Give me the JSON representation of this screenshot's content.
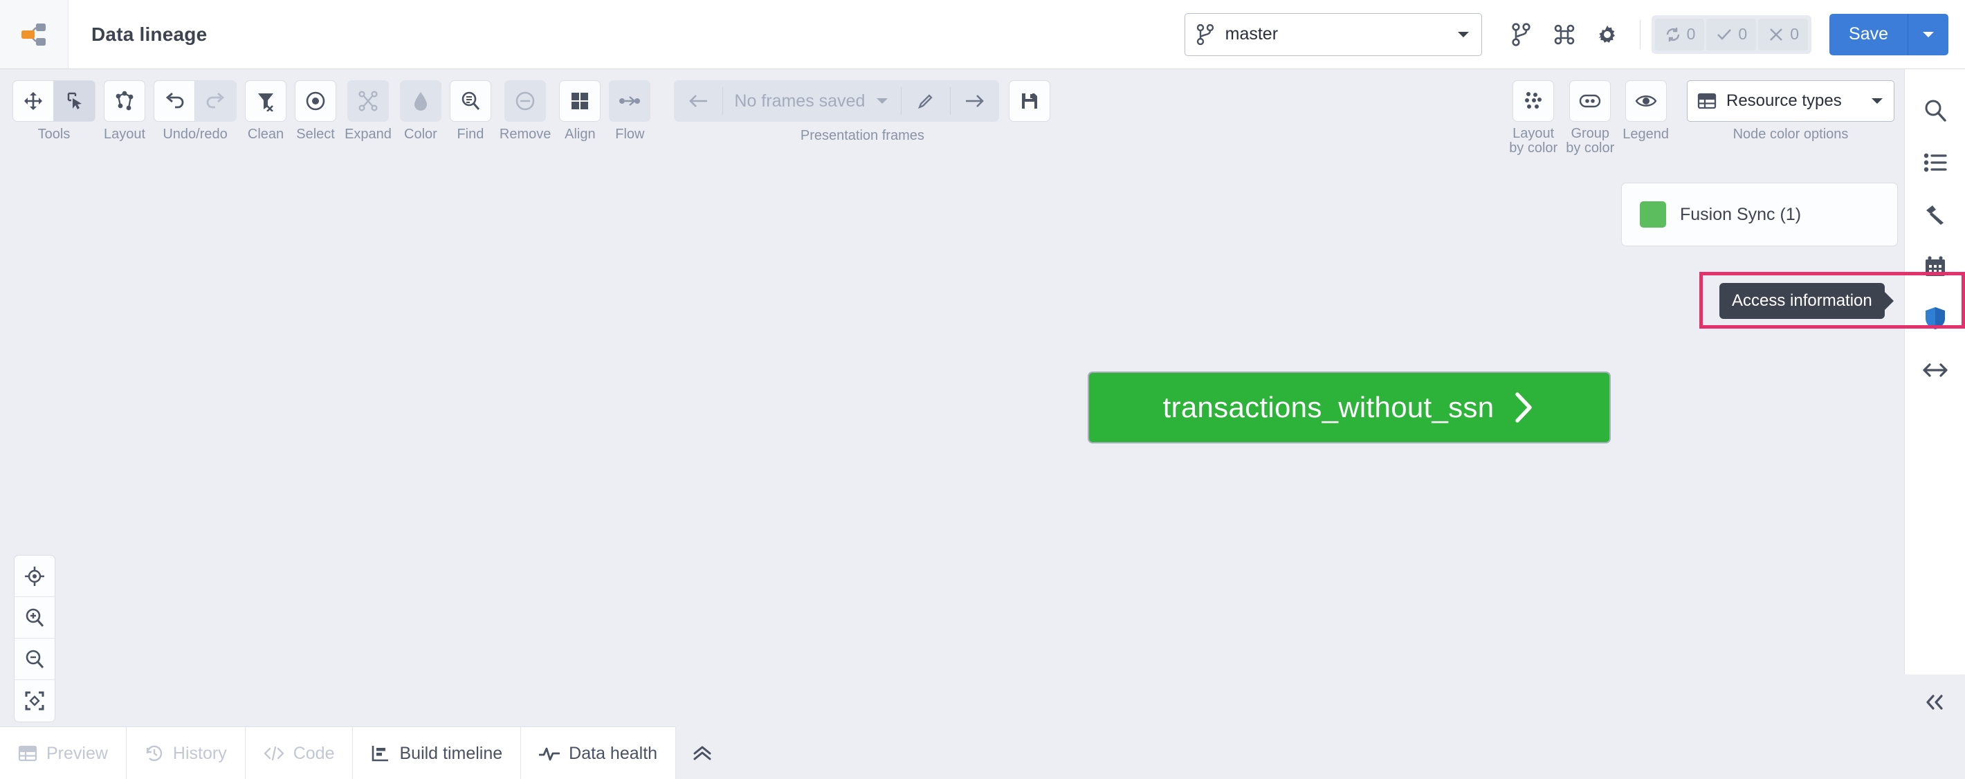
{
  "header": {
    "logo_icon": "lineage-graph-logo",
    "title": "Data lineage",
    "branch": {
      "icon": "branch-icon",
      "value": "master",
      "caret_icon": "chevron-down-icon"
    },
    "actions": [
      {
        "name": "branch-merge-button",
        "icon": "branch-merge-icon"
      },
      {
        "name": "command-button",
        "icon": "command-icon"
      },
      {
        "name": "settings-button",
        "icon": "gear-icon"
      }
    ],
    "status": [
      {
        "name": "status-pending",
        "icon": "sync-icon",
        "count": "0"
      },
      {
        "name": "status-success",
        "icon": "check-icon",
        "count": "0"
      },
      {
        "name": "status-failed",
        "icon": "close-icon",
        "count": "0"
      }
    ],
    "save_label": "Save",
    "save_caret_icon": "chevron-down-icon"
  },
  "toolbar": {
    "groups": [
      {
        "label": "Tools",
        "buttons": [
          "move-icon",
          "select-pointer-icon"
        ],
        "active_index": 1
      },
      {
        "label": "Layout",
        "buttons": [
          "layout-graph-icon"
        ]
      },
      {
        "label": "Undo/redo",
        "buttons": [
          "undo-icon",
          "redo-icon"
        ],
        "disabled_index": 1
      },
      {
        "label": "Clean",
        "buttons": [
          "filter-clear-icon"
        ]
      },
      {
        "label": "Select",
        "buttons": [
          "target-circle-icon"
        ]
      },
      {
        "label": "Expand",
        "buttons": [
          "expand-nodes-icon"
        ],
        "disabled_index": 0
      },
      {
        "label": "Color",
        "buttons": [
          "droplet-icon"
        ],
        "disabled_index": 0
      },
      {
        "label": "Find",
        "buttons": [
          "find-search-icon"
        ]
      },
      {
        "label": "Remove",
        "buttons": [
          "minus-circle-icon"
        ],
        "disabled_index": 0
      },
      {
        "label": "Align",
        "buttons": [
          "align-grid-icon"
        ]
      },
      {
        "label": "Flow",
        "buttons": [
          "flow-icon"
        ],
        "disabled_index": 0
      }
    ],
    "frames": {
      "back_icon": "arrow-left-icon",
      "value": "No frames saved",
      "caret_icon": "chevron-down-icon",
      "edit_icon": "pencil-icon",
      "forward_icon": "arrow-right-icon",
      "save_icon": "floppy-save-icon",
      "label": "Presentation frames"
    },
    "right_groups": [
      {
        "label_line1": "Layout",
        "label_line2": "by color",
        "icon": "layout-by-color-icon"
      },
      {
        "label_line1": "Group",
        "label_line2": "by color",
        "icon": "group-by-color-icon"
      },
      {
        "label_line1": "Legend",
        "label_line2": "",
        "icon": "eye-icon"
      }
    ],
    "node_color": {
      "icon": "table-icon",
      "value": "Resource types",
      "caret_icon": "chevron-down-icon",
      "label": "Node color options"
    }
  },
  "canvas": {
    "legend": {
      "swatch_color": "#5cbd5e",
      "label": "Fusion Sync (1)"
    },
    "node": {
      "label": "transactions_without_ssn",
      "color": "#2eb33a",
      "chevron_icon": "chevron-right-icon"
    },
    "tooltip": {
      "text": "Access information",
      "highlight_color": "#e4306b"
    },
    "zoom_controls": [
      {
        "name": "center-view-button",
        "icon": "target-icon"
      },
      {
        "name": "zoom-in-button",
        "icon": "zoom-in-icon"
      },
      {
        "name": "zoom-out-button",
        "icon": "zoom-out-icon"
      },
      {
        "name": "fit-screen-button",
        "icon": "fit-screen-icon"
      }
    ]
  },
  "sidebar": {
    "items": [
      {
        "name": "sidebar-search",
        "icon": "search-icon",
        "active": false
      },
      {
        "name": "sidebar-list",
        "icon": "list-icon",
        "active": false
      },
      {
        "name": "sidebar-build",
        "icon": "hammer-icon",
        "active": false
      },
      {
        "name": "sidebar-schedule",
        "icon": "calendar-icon",
        "active": false
      },
      {
        "name": "sidebar-access",
        "icon": "shield-icon",
        "active": true
      },
      {
        "name": "sidebar-resize",
        "icon": "arrows-horizontal-icon",
        "active": false
      }
    ],
    "collapse_icon": "chevron-double-left-icon"
  },
  "bottom": {
    "tabs": [
      {
        "label": "Preview",
        "icon": "table-icon",
        "enabled": false
      },
      {
        "label": "History",
        "icon": "history-icon",
        "enabled": false
      },
      {
        "label": "Code",
        "icon": "code-icon",
        "enabled": false
      },
      {
        "label": "Build timeline",
        "icon": "timeline-icon",
        "enabled": true
      },
      {
        "label": "Data health",
        "icon": "pulse-icon",
        "enabled": true
      }
    ],
    "expand_icon": "chevron-double-up-icon"
  }
}
